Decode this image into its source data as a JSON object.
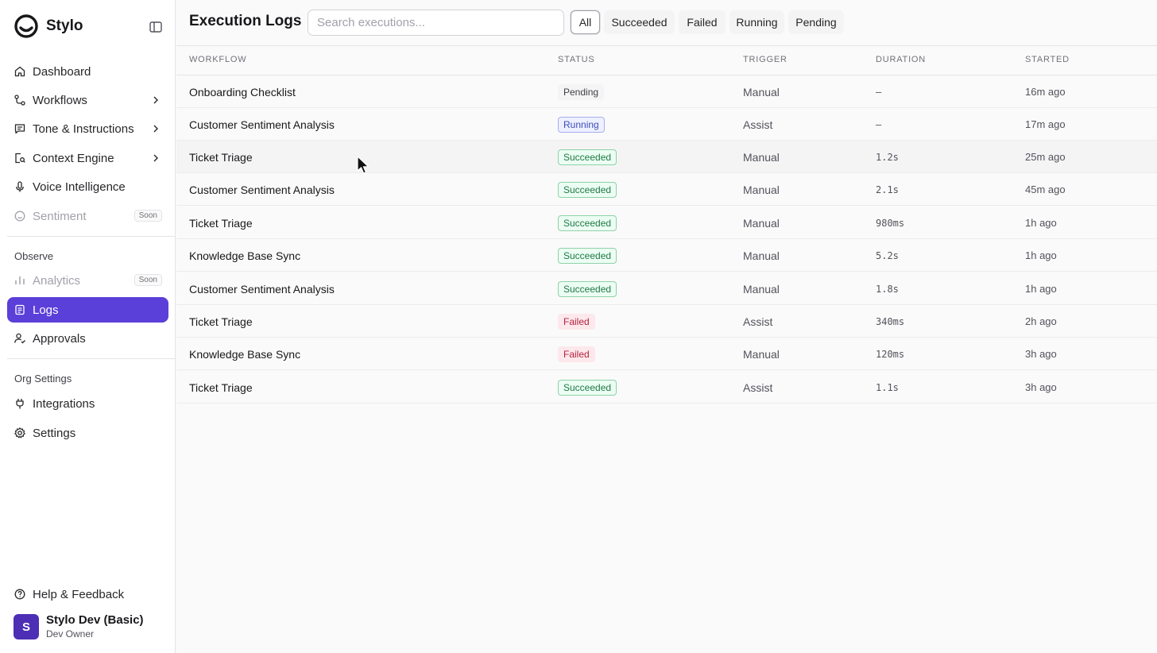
{
  "brand": {
    "name": "Stylo"
  },
  "nav": {
    "items": [
      {
        "label": "Dashboard",
        "icon": "home-icon"
      },
      {
        "label": "Workflows",
        "icon": "workflow-icon"
      },
      {
        "label": "Tone & Instructions",
        "icon": "message-icon"
      },
      {
        "label": "Context Engine",
        "icon": "search-doc-icon"
      },
      {
        "label": "Voice Intelligence",
        "icon": "microphone-icon"
      },
      {
        "label": "Sentiment",
        "icon": "smile-icon",
        "badge": "Soon"
      }
    ],
    "observe_label": "Observe",
    "observe_items": [
      {
        "label": "Analytics",
        "icon": "chart-icon",
        "badge": "Soon"
      },
      {
        "label": "Logs",
        "icon": "logs-icon"
      },
      {
        "label": "Approvals",
        "icon": "user-check-icon"
      }
    ],
    "org_label": "Org Settings",
    "org_items": [
      {
        "label": "Integrations",
        "icon": "plug-icon"
      },
      {
        "label": "Settings",
        "icon": "gear-icon"
      }
    ],
    "help_label": "Help & Feedback"
  },
  "user": {
    "initial": "S",
    "name": "Stylo Dev (Basic)",
    "role": "Dev Owner"
  },
  "header": {
    "title": "Execution Logs",
    "search_placeholder": "Search executions...",
    "filters": [
      "All",
      "Succeeded",
      "Failed",
      "Running",
      "Pending"
    ],
    "active_filter": "All"
  },
  "table": {
    "columns": [
      "WORKFLOW",
      "STATUS",
      "TRIGGER",
      "DURATION",
      "STARTED"
    ],
    "rows": [
      {
        "workflow": "Onboarding Checklist",
        "status": "Pending",
        "trigger": "Manual",
        "duration": "—",
        "started": "16m ago"
      },
      {
        "workflow": "Customer Sentiment Analysis",
        "status": "Running",
        "trigger": "Assist",
        "duration": "—",
        "started": "17m ago"
      },
      {
        "workflow": "Ticket Triage",
        "status": "Succeeded",
        "trigger": "Manual",
        "duration": "1.2s",
        "started": "25m ago"
      },
      {
        "workflow": "Customer Sentiment Analysis",
        "status": "Succeeded",
        "trigger": "Manual",
        "duration": "2.1s",
        "started": "45m ago"
      },
      {
        "workflow": "Ticket Triage",
        "status": "Succeeded",
        "trigger": "Manual",
        "duration": "980ms",
        "started": "1h ago"
      },
      {
        "workflow": "Knowledge Base Sync",
        "status": "Succeeded",
        "trigger": "Manual",
        "duration": "5.2s",
        "started": "1h ago"
      },
      {
        "workflow": "Customer Sentiment Analysis",
        "status": "Succeeded",
        "trigger": "Manual",
        "duration": "1.8s",
        "started": "1h ago"
      },
      {
        "workflow": "Ticket Triage",
        "status": "Failed",
        "trigger": "Assist",
        "duration": "340ms",
        "started": "2h ago"
      },
      {
        "workflow": "Knowledge Base Sync",
        "status": "Failed",
        "trigger": "Manual",
        "duration": "120ms",
        "started": "3h ago"
      },
      {
        "workflow": "Ticket Triage",
        "status": "Succeeded",
        "trigger": "Assist",
        "duration": "1.1s",
        "started": "3h ago"
      }
    ]
  },
  "colors": {
    "accent": "#5b3fd9",
    "succeeded": "#1f7a45",
    "failed": "#b4233f",
    "running": "#3d4fb8"
  }
}
